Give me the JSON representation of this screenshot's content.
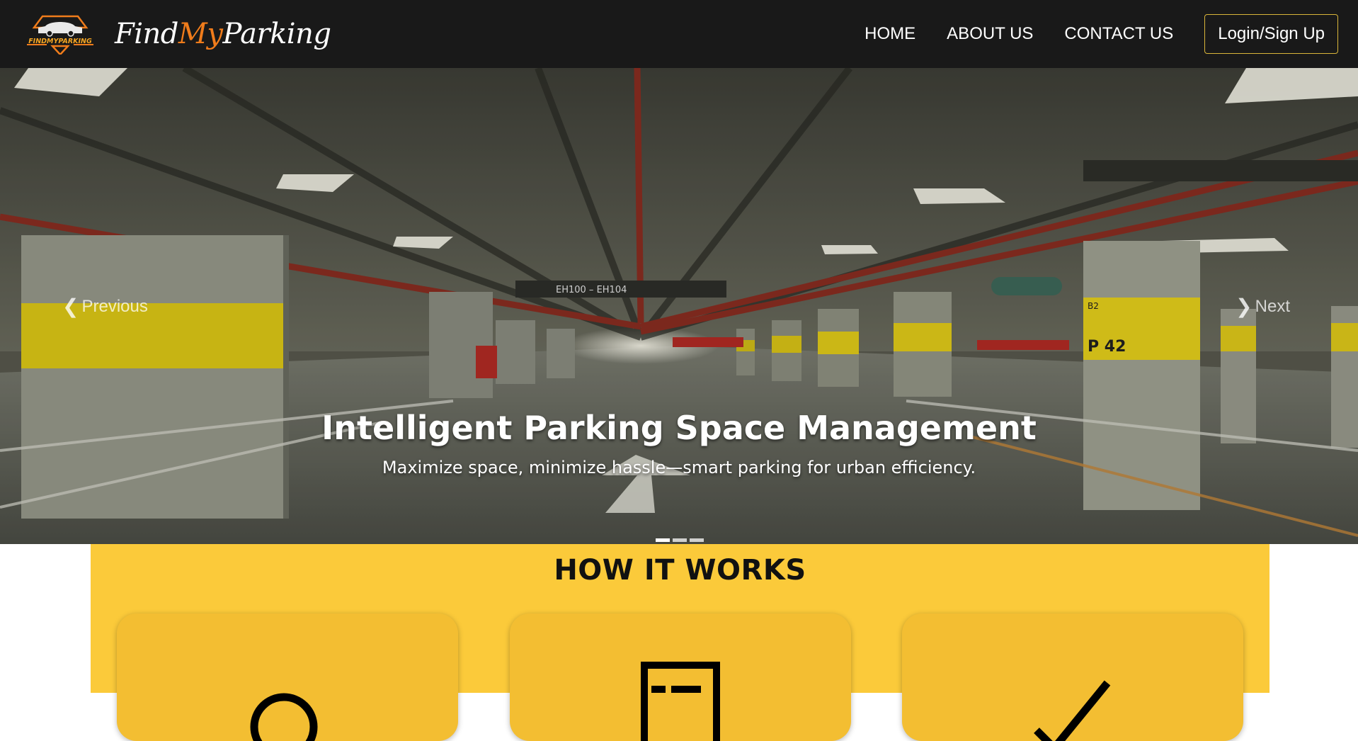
{
  "navbar": {
    "logo_text": "FINDMYPARKING",
    "brand_prefix": "Find",
    "brand_accent": "My",
    "brand_suffix": "Parking",
    "links": [
      "HOME",
      "ABOUT US",
      "CONTACT US"
    ],
    "login_label": "Login/Sign Up"
  },
  "hero": {
    "title": "Intelligent Parking Space Management",
    "subtitle": "Maximize space, minimize hassle—smart parking for urban efficiency.",
    "prev_label": "Previous",
    "next_label": "Next",
    "slide_count": 3,
    "active_slide": 1,
    "scene_signs": {
      "aisle": "EH100 – EH104",
      "pillar_level": "B2",
      "pillar_bay": "P 42"
    }
  },
  "how_it_works": {
    "title": "HOW IT WORKS",
    "steps": [
      {
        "icon": "search-icon"
      },
      {
        "icon": "list-card-icon"
      },
      {
        "icon": "checkmark-icon"
      }
    ]
  },
  "colors": {
    "navbar_bg": "#191919",
    "brand_accent": "#f07c1b",
    "login_border": "#d9b53a",
    "section_yellow": "#fbca3a",
    "card_yellow": "#f3be32"
  }
}
